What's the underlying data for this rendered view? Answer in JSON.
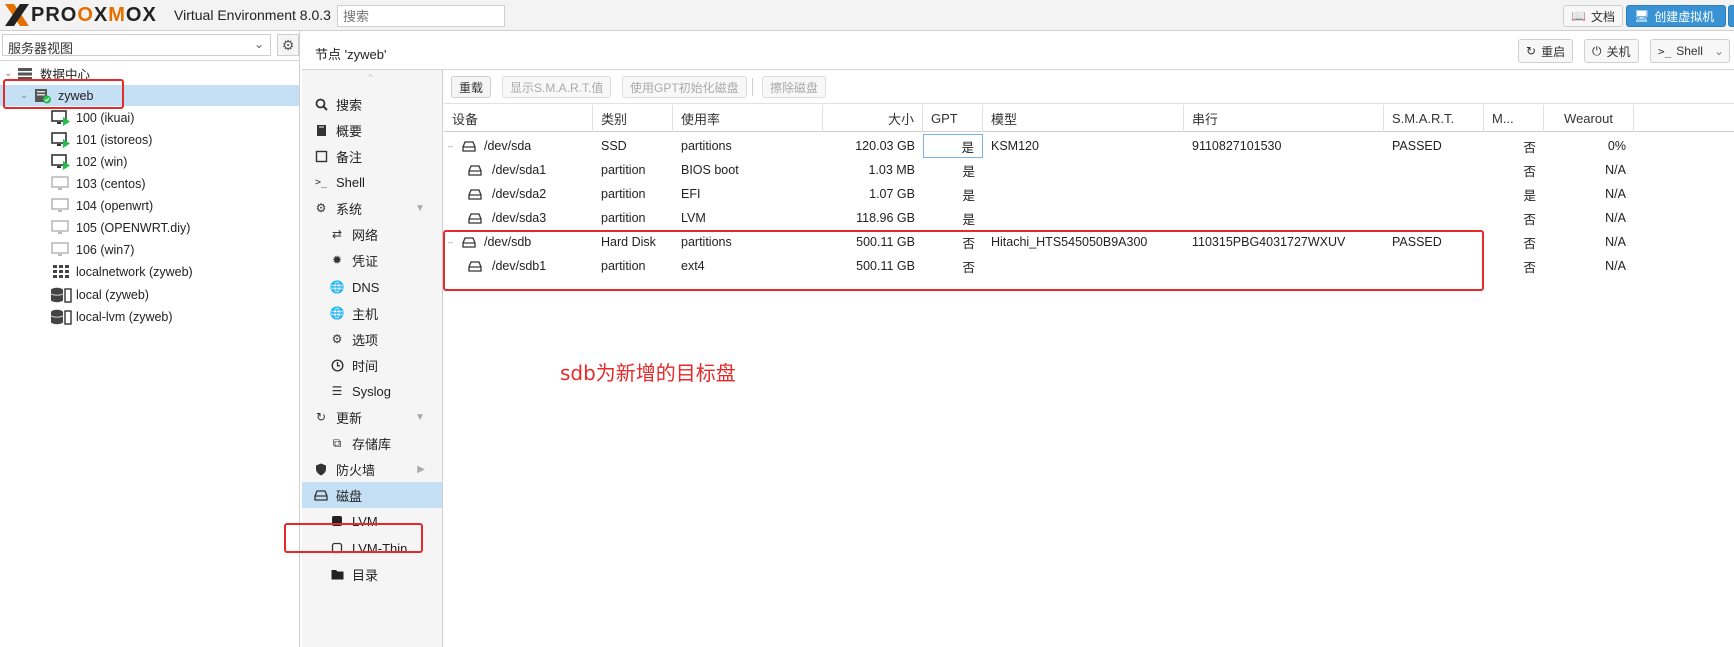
{
  "topbar": {
    "brand_left": "PRO",
    "brand_mid": "X",
    "brand_right": "MOX",
    "product": "Virtual Environment 8.0.3",
    "search_placeholder": "搜索",
    "docs_label": "文档",
    "create_vm_label": "创建虚拟机"
  },
  "tree": {
    "view_label": "服务器视图",
    "items": [
      {
        "label": "数据中心",
        "icon": "datacenter-icon"
      },
      {
        "label": "zyweb",
        "icon": "node-online-icon"
      },
      {
        "label": "100 (ikuai)",
        "icon": "vm-running-icon"
      },
      {
        "label": "101 (istoreos)",
        "icon": "vm-running-icon"
      },
      {
        "label": "102 (win)",
        "icon": "vm-running-icon"
      },
      {
        "label": "103 (centos)",
        "icon": "vm-stopped-icon"
      },
      {
        "label": "104 (openwrt)",
        "icon": "vm-stopped-icon"
      },
      {
        "label": "105 (OPENWRT.diy)",
        "icon": "vm-stopped-icon"
      },
      {
        "label": "106 (win7)",
        "icon": "vm-stopped-icon"
      },
      {
        "label": "localnetwork (zyweb)",
        "icon": "network-icon"
      },
      {
        "label": "local (zyweb)",
        "icon": "storage-icon"
      },
      {
        "label": "local-lvm (zyweb)",
        "icon": "storage-icon"
      }
    ]
  },
  "node_header": {
    "title": "节点 'zyweb'",
    "restart_label": "重启",
    "shutdown_label": "关机",
    "shell_label": "Shell"
  },
  "nav": {
    "items": [
      {
        "label": "搜索",
        "icon": "search-icon"
      },
      {
        "label": "概要",
        "icon": "book-icon"
      },
      {
        "label": "备注",
        "icon": "note-icon"
      },
      {
        "label": "Shell",
        "icon": "terminal-icon"
      },
      {
        "label": "系统",
        "icon": "gears-icon"
      },
      {
        "label": "网络",
        "icon": "network-icon"
      },
      {
        "label": "凭证",
        "icon": "certificate-icon"
      },
      {
        "label": "DNS",
        "icon": "globe-icon"
      },
      {
        "label": "主机",
        "icon": "globe-icon"
      },
      {
        "label": "选项",
        "icon": "gear-icon"
      },
      {
        "label": "时间",
        "icon": "clock-icon"
      },
      {
        "label": "Syslog",
        "icon": "list-icon"
      },
      {
        "label": "更新",
        "icon": "refresh-icon"
      },
      {
        "label": "存储库",
        "icon": "copy-icon"
      },
      {
        "label": "防火墙",
        "icon": "shield-icon"
      },
      {
        "label": "磁盘",
        "icon": "hdd-icon"
      },
      {
        "label": "LVM",
        "icon": "square-icon"
      },
      {
        "label": "LVM-Thin",
        "icon": "square-outline-icon"
      },
      {
        "label": "目录",
        "icon": "folder-icon"
      }
    ]
  },
  "toolbar": {
    "reload_label": "重载",
    "smart_label": "显示S.M.A.R.T.值",
    "gpt_label": "使用GPT初始化磁盘",
    "wipe_label": "擦除磁盘"
  },
  "grid": {
    "headers": {
      "device": "设备",
      "type": "类别",
      "usage": "使用率",
      "size": "大小",
      "gpt": "GPT",
      "model": "模型",
      "serial": "串行",
      "smart": "S.M.A.R.T.",
      "mounted": "M...",
      "wearout": "Wearout"
    },
    "rows": [
      {
        "device": "/dev/sda",
        "type": "SSD",
        "usage": "partitions",
        "size": "120.03 GB",
        "gpt": "是",
        "model": "KSM120",
        "serial": "9110827101530",
        "smart": "PASSED",
        "mounted": "否",
        "wearout": "0%"
      },
      {
        "device": "/dev/sda1",
        "type": "partition",
        "usage": "BIOS boot",
        "size": "1.03 MB",
        "gpt": "是",
        "model": "",
        "serial": "",
        "smart": "",
        "mounted": "否",
        "wearout": "N/A"
      },
      {
        "device": "/dev/sda2",
        "type": "partition",
        "usage": "EFI",
        "size": "1.07 GB",
        "gpt": "是",
        "model": "",
        "serial": "",
        "smart": "",
        "mounted": "是",
        "wearout": "N/A"
      },
      {
        "device": "/dev/sda3",
        "type": "partition",
        "usage": "LVM",
        "size": "118.96 GB",
        "gpt": "是",
        "model": "",
        "serial": "",
        "smart": "",
        "mounted": "否",
        "wearout": "N/A"
      },
      {
        "device": "/dev/sdb",
        "type": "Hard Disk",
        "usage": "partitions",
        "size": "500.11 GB",
        "gpt": "否",
        "model": "Hitachi_HTS545050B9A300",
        "serial": "110315PBG4031727WXUV",
        "smart": "PASSED",
        "mounted": "否",
        "wearout": "N/A"
      },
      {
        "device": "/dev/sdb1",
        "type": "partition",
        "usage": "ext4",
        "size": "500.11 GB",
        "gpt": "否",
        "model": "",
        "serial": "",
        "smart": "",
        "mounted": "否",
        "wearout": "N/A"
      }
    ]
  },
  "annotation": "sdb为新增的目标盘",
  "colors": {
    "accent": "#3892d4",
    "selection": "#c5dff5",
    "annotation_red": "#e42a2a",
    "brand_orange": "#e57000"
  }
}
